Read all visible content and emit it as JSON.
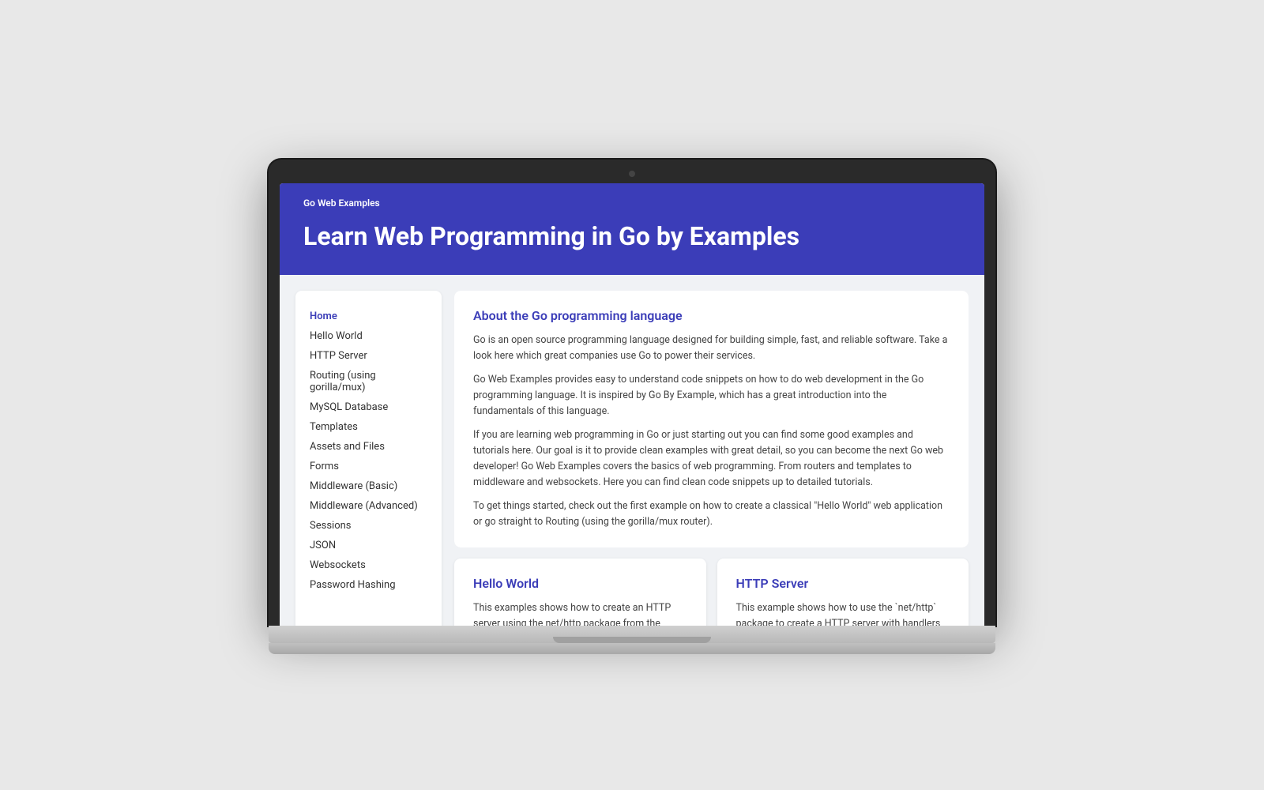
{
  "laptop": {
    "visible": true
  },
  "site": {
    "logo": "Go Web Examples",
    "hero_title": "Learn Web Programming in Go by Examples",
    "header_bg": "#3b3db8"
  },
  "sidebar": {
    "active_item": "Home",
    "items": [
      {
        "label": "Home",
        "active": true
      },
      {
        "label": "Hello World",
        "active": false
      },
      {
        "label": "HTTP Server",
        "active": false
      },
      {
        "label": "Routing (using gorilla/mux)",
        "active": false
      },
      {
        "label": "MySQL Database",
        "active": false
      },
      {
        "label": "Templates",
        "active": false
      },
      {
        "label": "Assets and Files",
        "active": false
      },
      {
        "label": "Forms",
        "active": false
      },
      {
        "label": "Middleware (Basic)",
        "active": false
      },
      {
        "label": "Middleware (Advanced)",
        "active": false
      },
      {
        "label": "Sessions",
        "active": false
      },
      {
        "label": "JSON",
        "active": false
      },
      {
        "label": "Websockets",
        "active": false
      },
      {
        "label": "Password Hashing",
        "active": false
      }
    ]
  },
  "main_card": {
    "title": "About the Go programming language",
    "paragraphs": [
      "Go is an open source programming language designed for building simple, fast, and reliable software. Take a look here which great companies use Go to power their services.",
      "Go Web Examples provides easy to understand code snippets on how to do web development in the Go programming language. It is inspired by Go By Example, which has a great introduction into the fundamentals of this language.",
      "If you are learning web programming in Go or just starting out you can find some good examples and tutorials here. Our goal is it to provide clean examples with great detail, so you can become the next Go web developer! Go Web Examples covers the basics of web programming. From routers and templates to middleware and websockets. Here you can find clean code snippets up to detailed tutorials.",
      "To get things started, check out the first example on how to create a classical \"Hello World\" web application or go straight to Routing (using the gorilla/mux router)."
    ]
  },
  "card_hello_world": {
    "title": "Hello World",
    "text": "This examples shows how to create an HTTP server using the net/http package from the standard library. It contains all functionalities about the HTTP protocol."
  },
  "card_http_server": {
    "title": "HTTP Server",
    "text": "This example shows how to use the `net/http` package to create a HTTP server with handlers and static files."
  }
}
